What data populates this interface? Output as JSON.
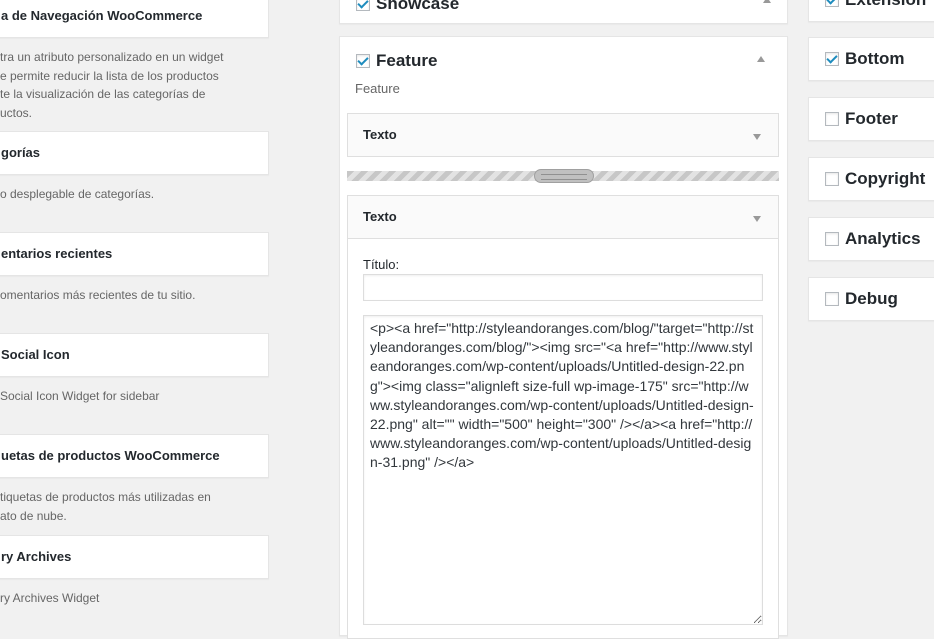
{
  "available_widgets": [
    {
      "title": "a de Navegación WooCommerce",
      "description": "tra un atributo personalizado en un widget\ne permite reducir la lista de los productos\nte la visualización de las categorías de\nuctos."
    },
    {
      "title": "gorías",
      "description": "o desplegable de categorías."
    },
    {
      "title": "entarios recientes",
      "description": "omentarios más recientes de tu sitio."
    },
    {
      "title": "Social Icon",
      "description": "Social Icon Widget for sidebar"
    },
    {
      "title": "uetas de productos WooCommerce",
      "description": "tiquetas de productos más utilizadas en\nato de nube."
    },
    {
      "title": "ry Archives",
      "description": "ry Archives Widget"
    }
  ],
  "middle": {
    "showcase": {
      "label": "Showcase",
      "checked": true
    },
    "feature": {
      "label": "Feature",
      "checked": true,
      "description": "Feature"
    },
    "widget_collapsed": {
      "label": "Texto"
    },
    "widget_open": {
      "label": "Texto",
      "title_label": "Título:",
      "title_value": "",
      "content": "<p><a href=\"http://styleandoranges.com/blog/\"target=\"http://styleandoranges.com/blog/\"><img src=\"<a href=\"http://www.styleandoranges.com/wp-content/uploads/Untitled-design-22.png\"><img class=\"alignleft size-full wp-image-175\" src=\"http://www.styleandoranges.com/wp-content/uploads/Untitled-design-22.png\" alt=\"\" width=\"500\" height=\"300\" /></a><a href=\"http://www.styleandoranges.com/wp-content/uploads/Untitled-design-31.png\" /></a>"
    }
  },
  "right_sidebars": [
    {
      "label": "Extension",
      "checked": true
    },
    {
      "label": "Bottom",
      "checked": true
    },
    {
      "label": "Footer",
      "checked": false
    },
    {
      "label": "Copyright",
      "checked": false
    },
    {
      "label": "Analytics",
      "checked": false
    },
    {
      "label": "Debug",
      "checked": false
    }
  ],
  "colors": {
    "checkmark": "#1e8cbe",
    "background": "#f1f1f1"
  }
}
